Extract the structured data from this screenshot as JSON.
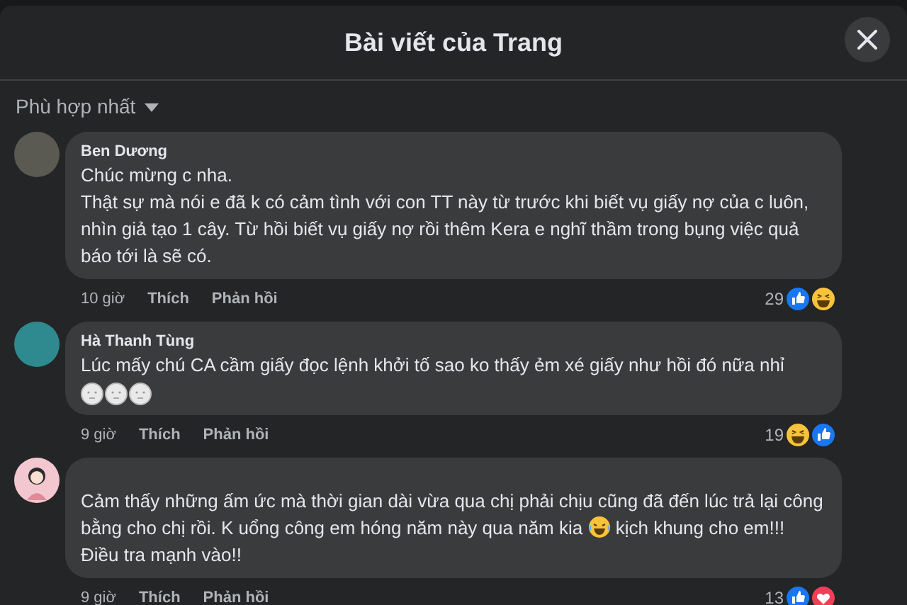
{
  "dialog": {
    "title": "Bài viết của Trang"
  },
  "sort": {
    "label": "Phù hợp nhất"
  },
  "comments": [
    {
      "author": "Ben Dương",
      "avatar": {
        "kind": "photo"
      },
      "parts": [
        {
          "kind": "text",
          "text": "Chúc mừng c nha.\nThật sự mà nói e đã k có cảm tình với con TT này từ trước khi biết vụ giấy nợ của c luôn, nhìn giả tạo 1 cây. Từ hồi biết vụ giấy nợ rồi thêm Kera e nghĩ thầm trong bụng việc quả báo tới là sẽ có."
        }
      ],
      "time": "10 giờ",
      "like": "Thích",
      "reply": "Phản hồi",
      "count": "29",
      "reactions": [
        {
          "kind": "like"
        },
        {
          "kind": "haha"
        }
      ]
    },
    {
      "author": "Hà Thanh Tùng",
      "avatar": {
        "kind": "photo"
      },
      "parts": [
        {
          "kind": "text",
          "text": "Lúc mấy chú CA cầm giấy đọc lệnh khởi tố sao ko thấy ẻm xé giấy như hồi đó nữa nhỉ"
        }
      ],
      "stickers": [
        {
          "kind": "face"
        },
        {
          "kind": "face"
        },
        {
          "kind": "face"
        }
      ],
      "time": "9 giờ",
      "like": "Thích",
      "reply": "Phản hồi",
      "count": "19",
      "reactions": [
        {
          "kind": "haha"
        },
        {
          "kind": "like"
        }
      ]
    },
    {
      "avatar": {
        "kind": "cartoon"
      },
      "parts": [
        {
          "kind": "text",
          "text": "Cảm thấy những ấm ức mà thời gian dài vừa qua chị phải chịu cũng đã đến lúc trả lại công bằng cho chị rồi. K uổng công em hóng năm này qua năm kia "
        },
        {
          "kind": "emoji"
        },
        {
          "kind": "text",
          "text": " kịch khung cho em!!! Điều tra mạnh vào!!"
        }
      ],
      "time": "9 giờ",
      "like": "Thích",
      "reply": "Phản hồi",
      "count": "13",
      "reactions": [
        {
          "kind": "like"
        },
        {
          "kind": "love"
        }
      ]
    }
  ]
}
